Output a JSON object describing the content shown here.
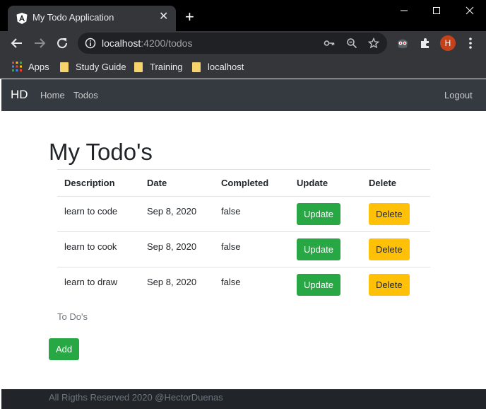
{
  "browser": {
    "tab_title": "My Todo Application",
    "url_host": "localhost",
    "url_path": ":4200/todos",
    "avatar_letter": "H",
    "bookmarks": [
      {
        "label": "Apps",
        "icon": "apps-grid-icon"
      },
      {
        "label": "Study Guide",
        "icon": "folder-icon"
      },
      {
        "label": "Training",
        "icon": "folder-icon"
      },
      {
        "label": "localhost",
        "icon": "folder-icon"
      }
    ]
  },
  "navbar": {
    "brand": "HD",
    "links": [
      "Home",
      "Todos"
    ],
    "logout": "Logout"
  },
  "main": {
    "heading": "My Todo's",
    "columns": [
      "Description",
      "Date",
      "Completed",
      "Update",
      "Delete"
    ],
    "rows": [
      {
        "description": "learn to code",
        "date": "Sep 8, 2020",
        "completed": "false",
        "update": "Update",
        "delete": "Delete"
      },
      {
        "description": "learn to cook",
        "date": "Sep 8, 2020",
        "completed": "false",
        "update": "Update",
        "delete": "Delete"
      },
      {
        "description": "learn to draw",
        "date": "Sep 8, 2020",
        "completed": "false",
        "update": "Update",
        "delete": "Delete"
      }
    ],
    "caption": "To Do's",
    "add_label": "Add"
  },
  "footer": {
    "text": "All Rigths Reserved 2020 @HectorDuenas"
  },
  "colors": {
    "navbar": "#343a40",
    "success": "#28a745",
    "warning": "#ffc107",
    "footer": "#212529"
  }
}
